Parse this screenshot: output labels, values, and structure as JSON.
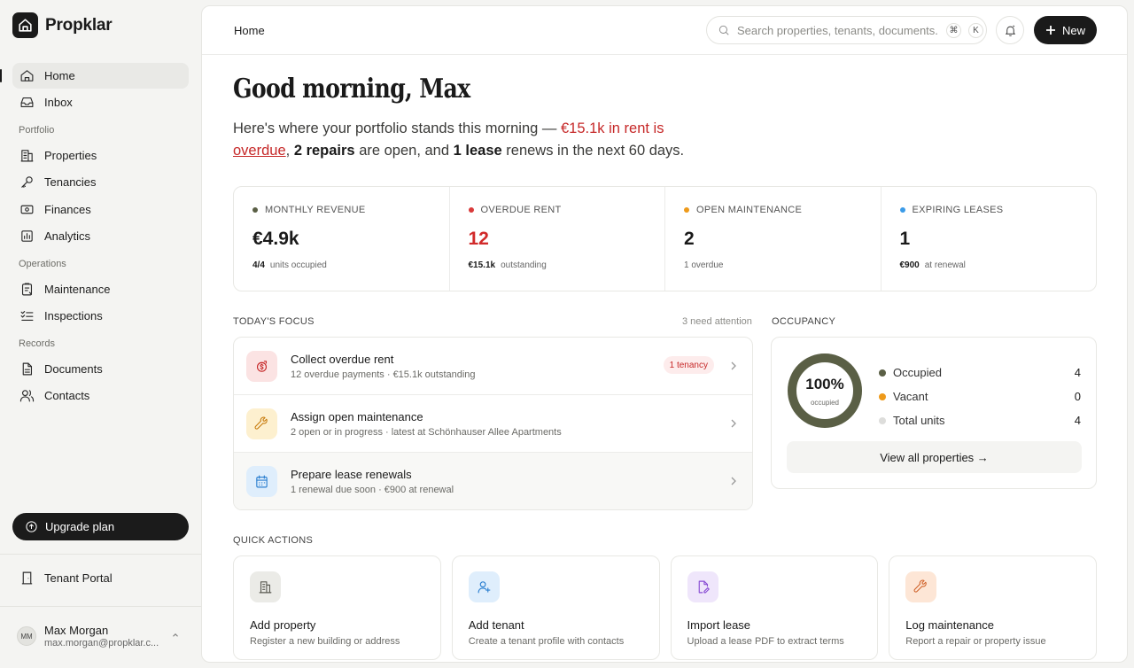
{
  "app": {
    "name": "Propklar"
  },
  "sidebar": {
    "nav_main": [
      {
        "label": "Home",
        "icon": "home-icon",
        "active": true
      },
      {
        "label": "Inbox",
        "icon": "inbox-icon"
      }
    ],
    "sections": [
      {
        "title": "Portfolio",
        "items": [
          {
            "label": "Properties",
            "icon": "building-icon"
          },
          {
            "label": "Tenancies",
            "icon": "key-icon"
          },
          {
            "label": "Finances",
            "icon": "banknote-icon"
          },
          {
            "label": "Analytics",
            "icon": "chart-icon"
          }
        ]
      },
      {
        "title": "Operations",
        "items": [
          {
            "label": "Maintenance",
            "icon": "clipboard-icon"
          },
          {
            "label": "Inspections",
            "icon": "checklist-icon"
          }
        ]
      },
      {
        "title": "Records",
        "items": [
          {
            "label": "Documents",
            "icon": "document-icon"
          },
          {
            "label": "Contacts",
            "icon": "contacts-icon"
          }
        ]
      }
    ],
    "upgrade_label": "Upgrade plan",
    "portal_label": "Tenant Portal",
    "user": {
      "initials": "MM",
      "name": "Max Morgan",
      "email": "max.morgan@propklar.c..."
    }
  },
  "header": {
    "breadcrumb": "Home",
    "search_placeholder": "Search properties, tenants, documents...",
    "shortcut_keys": [
      "⌘",
      "K"
    ],
    "new_label": "New"
  },
  "greeting": "Good morning, Max",
  "summary": {
    "lead": "Here's where your portfolio stands this morning — ",
    "overdue_amount": "€15.1k",
    "overdue_mid": " in rent is ",
    "overdue_word": "overdue",
    "comma": ", ",
    "repairs": "2 repairs",
    "repairs_tail": " are open, and ",
    "lease": "1 lease",
    "lease_tail": " renews in the next 60 days."
  },
  "stats": [
    {
      "label": "MONTHLY REVENUE",
      "dot": "#5a5f45",
      "value": "€4.9k",
      "sub_bold": "4/4",
      "sub": "units occupied"
    },
    {
      "label": "OVERDUE RENT",
      "dot": "#d93a3a",
      "value": "12",
      "sub_bold": "€15.1k",
      "sub": "outstanding"
    },
    {
      "label": "OPEN MAINTENANCE",
      "dot": "#ee9a1a",
      "value": "2",
      "sub_bold": "",
      "sub": "1 overdue"
    },
    {
      "label": "EXPIRING LEASES",
      "dot": "#3b9be8",
      "value": "1",
      "sub_bold": "€900",
      "sub": "at renewal"
    }
  ],
  "focus": {
    "heading": "TODAY'S FOCUS",
    "aside": "3 need attention",
    "items": [
      {
        "title": "Collect overdue rent",
        "sub": "12 overdue payments · €15.1k outstanding",
        "badge": "1 tenancy",
        "icon": "coin-icon"
      },
      {
        "title": "Assign open maintenance",
        "sub": "2 open or in progress · latest at Schönhauser Allee Apartments",
        "icon": "wrench-icon"
      },
      {
        "title": "Prepare lease renewals",
        "sub": "1 renewal due soon · €900 at renewal",
        "icon": "calendar-icon"
      }
    ]
  },
  "occupancy": {
    "heading": "OCCUPANCY",
    "percent": "100%",
    "percent_value": 1.0,
    "caption": "occupied",
    "legend": [
      {
        "label": "Occupied",
        "value": "4",
        "color": "#5a5f45"
      },
      {
        "label": "Vacant",
        "value": "0",
        "color": "#ee9a1a"
      },
      {
        "label": "Total units",
        "value": "4",
        "color": "#dddddb"
      }
    ],
    "view_all": "View all properties →"
  },
  "quick_actions": {
    "heading": "QUICK ACTIONS",
    "items": [
      {
        "title": "Add property",
        "sub": "Register a new building or address",
        "icon": "building-icon"
      },
      {
        "title": "Add tenant",
        "sub": "Create a tenant profile with contacts",
        "icon": "user-plus-icon"
      },
      {
        "title": "Import lease",
        "sub": "Upload a lease PDF to extract terms",
        "icon": "file-edit-icon"
      },
      {
        "title": "Log maintenance",
        "sub": "Report a repair or property issue",
        "icon": "wrench-icon"
      }
    ]
  }
}
